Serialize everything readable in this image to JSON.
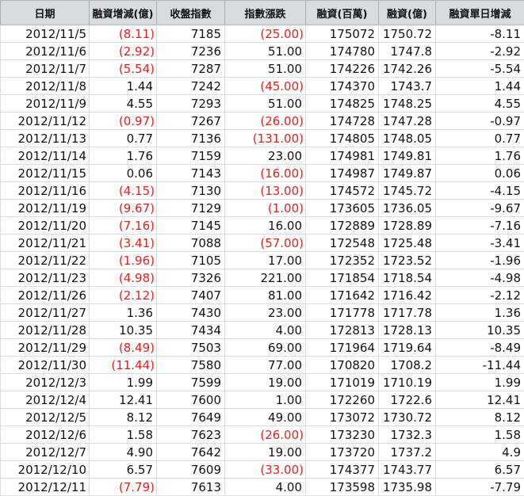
{
  "sheet": {
    "headers": [
      "日期",
      "融資增減(億)",
      "收盤指數",
      "指數漲跌",
      "融資(百萬)",
      "融資(億)",
      "融資單日增減"
    ],
    "neg_color": "#e8201c",
    "rows": [
      [
        "2012/11/5",
        "(8.11)",
        "7185",
        "(25.00)",
        "175072",
        "1750.72",
        "-8.11"
      ],
      [
        "2012/11/6",
        "(2.92)",
        "7236",
        "51.00",
        "174780",
        "1747.8",
        "-2.92"
      ],
      [
        "2012/11/7",
        "(5.54)",
        "7287",
        "51.00",
        "174226",
        "1742.26",
        "-5.54"
      ],
      [
        "2012/11/8",
        "1.44",
        "7242",
        "(45.00)",
        "174370",
        "1743.7",
        "1.44"
      ],
      [
        "2012/11/9",
        "4.55",
        "7293",
        "51.00",
        "174825",
        "1748.25",
        "4.55"
      ],
      [
        "2012/11/12",
        "(0.97)",
        "7267",
        "(26.00)",
        "174728",
        "1747.28",
        "-0.97"
      ],
      [
        "2012/11/13",
        "0.77",
        "7136",
        "(131.00)",
        "174805",
        "1748.05",
        "0.77"
      ],
      [
        "2012/11/14",
        "1.76",
        "7159",
        "23.00",
        "174981",
        "1749.81",
        "1.76"
      ],
      [
        "2012/11/15",
        "0.06",
        "7143",
        "(16.00)",
        "174987",
        "1749.87",
        "0.06"
      ],
      [
        "2012/11/16",
        "(4.15)",
        "7130",
        "(13.00)",
        "174572",
        "1745.72",
        "-4.15"
      ],
      [
        "2012/11/19",
        "(9.67)",
        "7129",
        "(1.00)",
        "173605",
        "1736.05",
        "-9.67"
      ],
      [
        "2012/11/20",
        "(7.16)",
        "7145",
        "16.00",
        "172889",
        "1728.89",
        "-7.16"
      ],
      [
        "2012/11/21",
        "(3.41)",
        "7088",
        "(57.00)",
        "172548",
        "1725.48",
        "-3.41"
      ],
      [
        "2012/11/22",
        "(1.96)",
        "7105",
        "17.00",
        "172352",
        "1723.52",
        "-1.96"
      ],
      [
        "2012/11/23",
        "(4.98)",
        "7326",
        "221.00",
        "171854",
        "1718.54",
        "-4.98"
      ],
      [
        "2012/11/26",
        "(2.12)",
        "7407",
        "81.00",
        "171642",
        "1716.42",
        "-2.12"
      ],
      [
        "2012/11/27",
        "1.36",
        "7430",
        "23.00",
        "171778",
        "1717.78",
        "1.36"
      ],
      [
        "2012/11/28",
        "10.35",
        "7434",
        "4.00",
        "172813",
        "1728.13",
        "10.35"
      ],
      [
        "2012/11/29",
        "(8.49)",
        "7503",
        "69.00",
        "171964",
        "1719.64",
        "-8.49"
      ],
      [
        "2012/11/30",
        "(11.44)",
        "7580",
        "77.00",
        "170820",
        "1708.2",
        "-11.44"
      ],
      [
        "2012/12/3",
        "1.99",
        "7599",
        "19.00",
        "171019",
        "1710.19",
        "1.99"
      ],
      [
        "2012/12/4",
        "12.41",
        "7600",
        "1.00",
        "172260",
        "1722.6",
        "12.41"
      ],
      [
        "2012/12/5",
        "8.12",
        "7649",
        "49.00",
        "173072",
        "1730.72",
        "8.12"
      ],
      [
        "2012/12/6",
        "1.58",
        "7623",
        "(26.00)",
        "173230",
        "1732.3",
        "1.58"
      ],
      [
        "2012/12/7",
        "4.90",
        "7642",
        "19.00",
        "173720",
        "1737.2",
        "4.9"
      ],
      [
        "2012/12/10",
        "6.57",
        "7609",
        "(33.00)",
        "174377",
        "1743.77",
        "6.57"
      ],
      [
        "2012/12/11",
        "(7.79)",
        "7613",
        "4.00",
        "173598",
        "1735.98",
        "-7.79"
      ]
    ]
  }
}
